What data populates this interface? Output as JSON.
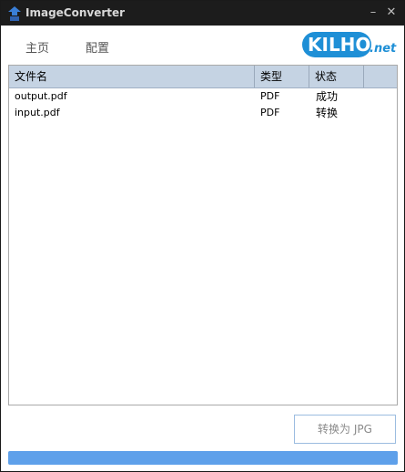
{
  "window": {
    "title": "ImageConverter",
    "minimize_glyph": "–",
    "close_glyph": "✕"
  },
  "tabs": [
    {
      "label": "主页"
    },
    {
      "label": "配置"
    }
  ],
  "logo": {
    "text": "KILHO",
    "suffix": ".net"
  },
  "file_list": {
    "columns": [
      "文件名",
      "类型",
      "状态"
    ],
    "rows": [
      {
        "name": "output.pdf",
        "type": "PDF",
        "status": "成功"
      },
      {
        "name": "input.pdf",
        "type": "PDF",
        "status": "转换"
      }
    ]
  },
  "convert_button": {
    "label": "转换为 JPG"
  },
  "progress": {
    "value": 1.0
  },
  "colors": {
    "accent": "#5ea0ea",
    "titlebar": "#1c1c1c",
    "list_header": "#c5d3e3",
    "logo": "#1e8fd6"
  }
}
